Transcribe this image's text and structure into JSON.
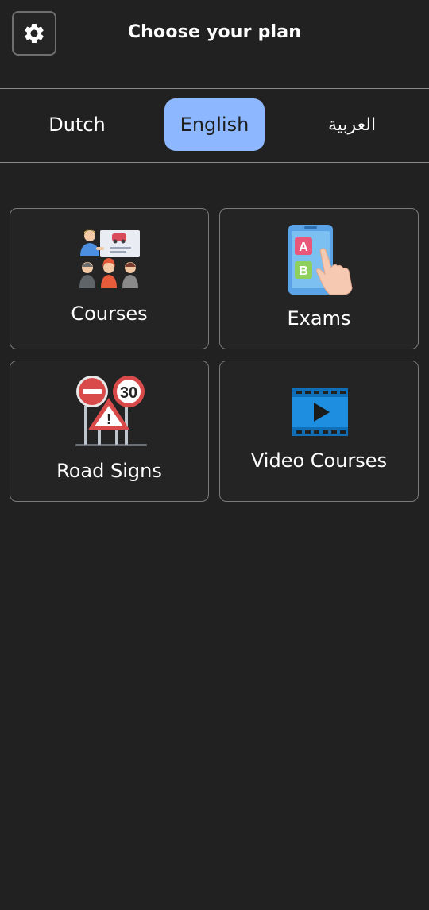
{
  "header": {
    "title": "Choose your plan",
    "settings_icon": "gear-icon"
  },
  "tabs": [
    {
      "label": "Dutch",
      "active": false
    },
    {
      "label": "English",
      "active": true
    },
    {
      "label": "العربية",
      "active": false
    }
  ],
  "cards": [
    {
      "label": "Courses",
      "icon": "classroom-icon"
    },
    {
      "label": "Exams",
      "icon": "phone-quiz-icon"
    },
    {
      "label": "Road Signs",
      "icon": "road-signs-icon",
      "sign_number": "30",
      "warning_mark": "!"
    },
    {
      "label": "Video Courses",
      "icon": "video-play-icon"
    }
  ],
  "colors": {
    "background": "#212121",
    "active_tab": "#8db7ff",
    "card_border": "#7a7a7a"
  }
}
